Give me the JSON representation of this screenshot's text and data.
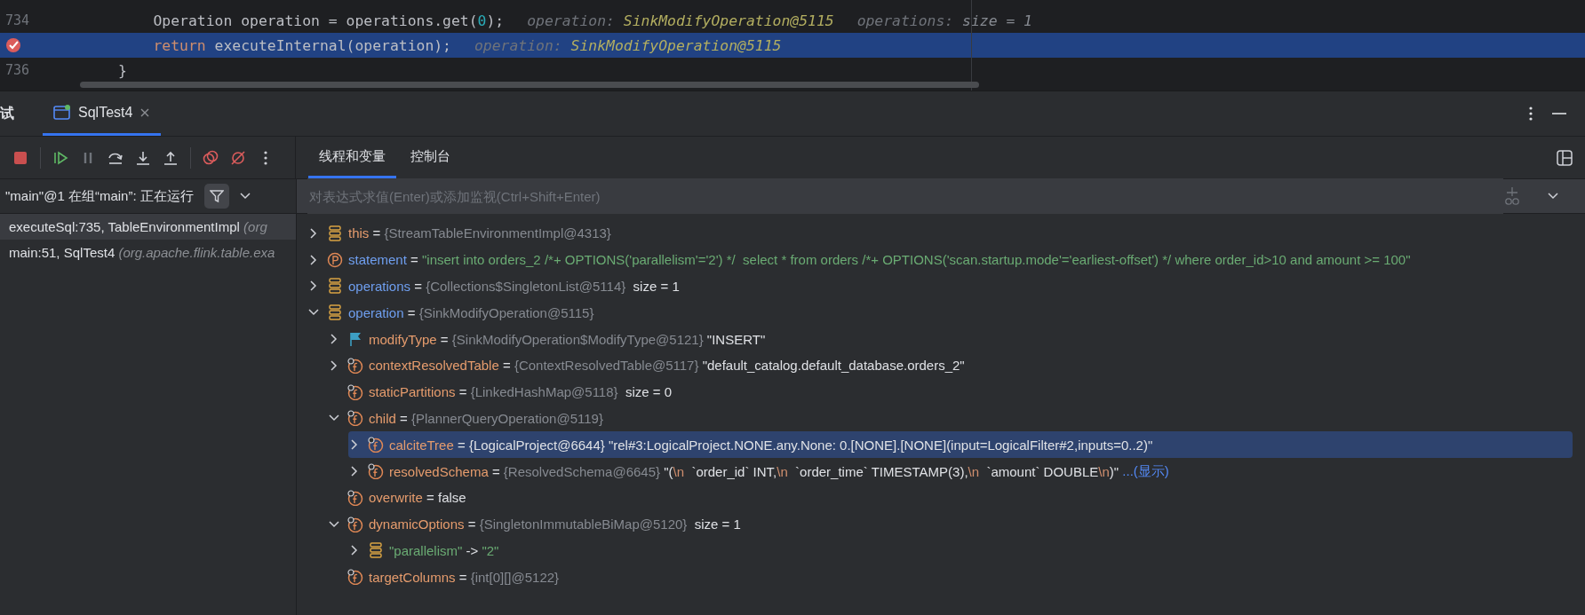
{
  "editor": {
    "lines": [
      {
        "number": "734",
        "selected": false,
        "breakpoint": false,
        "code": [
          {
            "kind": "code",
            "text": "    Operation operation = operations.get("
          },
          {
            "kind": "number",
            "text": "0"
          },
          {
            "kind": "code",
            "text": ");"
          }
        ],
        "hints": [
          {
            "label": "operation:",
            "value": "SinkModifyOperation@5115",
            "kind": "object"
          },
          {
            "label": "operations:",
            "value": "size = 1",
            "kind": "plain"
          }
        ]
      },
      {
        "selected": true,
        "breakpoint": true,
        "code": [
          {
            "kind": "keyword",
            "text": "    return"
          },
          {
            "kind": "code",
            "text": " executeInternal(operation);"
          }
        ],
        "hints": [
          {
            "label": "operation:",
            "value": "SinkModifyOperation@5115",
            "kind": "object"
          }
        ]
      },
      {
        "number": "736",
        "selected": false,
        "breakpoint": false,
        "code": [
          {
            "kind": "code",
            "text": "}"
          }
        ]
      }
    ]
  },
  "tool_window": {
    "title": "试",
    "tabs": [
      {
        "label": "SqlTest4",
        "selected": true
      }
    ]
  },
  "panel_tabs": [
    {
      "label": "线程和变量",
      "selected": true
    },
    {
      "label": "控制台",
      "selected": false
    }
  ],
  "thread": {
    "label": "\"main\"@1 在组“main”: 正在运行"
  },
  "frames": [
    {
      "method": "executeSql:735, TableEnvironmentImpl",
      "location": "(org",
      "selected": true
    },
    {
      "method": "main:51, SqlTest4",
      "location": "(org.apache.flink.table.exa",
      "selected": false
    }
  ],
  "evaluate": {
    "placeholder": "对表达式求值(Enter)或添加监视(Ctrl+Shift+Enter)"
  },
  "variables": [
    {
      "kind": "this",
      "name": "this",
      "expanded": false,
      "selected": false,
      "value": [
        {
          "kind": "op",
          "text": " = "
        },
        {
          "kind": "type",
          "text": "{StreamTableEnvironmentImpl@4313}"
        }
      ]
    },
    {
      "kind": "param",
      "name": "statement",
      "expanded": false,
      "selected": false,
      "value": [
        {
          "kind": "op",
          "text": " = "
        },
        {
          "kind": "str",
          "text": "\"insert into orders_2 /*+ OPTIONS('parallelism'='2') */  select * from orders /*+ OPTIONS('scan.startup.mode'='earliest-offset') */ where order_id>10 and amount >= 100\""
        }
      ]
    },
    {
      "kind": "local",
      "name": "operations",
      "expanded": false,
      "selected": false,
      "value": [
        {
          "kind": "op",
          "text": " = "
        },
        {
          "kind": "type",
          "text": "{Collections$SingletonList@5114}"
        },
        {
          "kind": "plain",
          "text": "  size = 1"
        }
      ]
    },
    {
      "kind": "local",
      "name": "operation",
      "expanded": true,
      "selected": false,
      "value": [
        {
          "kind": "op",
          "text": " = "
        },
        {
          "kind": "type",
          "text": "{SinkModifyOperation@5115}"
        }
      ],
      "children": [
        {
          "kind": "enum",
          "name": "modifyType",
          "expanded": false,
          "selected": false,
          "value": [
            {
              "kind": "op",
              "text": " = "
            },
            {
              "kind": "type",
              "text": "{SinkModifyOperation$ModifyType@5121}"
            },
            {
              "kind": "plain",
              "text": " \"INSERT\""
            }
          ]
        },
        {
          "kind": "field",
          "name": "contextResolvedTable",
          "expanded": false,
          "selected": false,
          "value": [
            {
              "kind": "op",
              "text": " = "
            },
            {
              "kind": "type",
              "text": "{ContextResolvedTable@5117}"
            },
            {
              "kind": "plain",
              "text": " \"default_catalog.default_database.orders_2\""
            }
          ]
        },
        {
          "kind": "field",
          "name": "staticPartitions",
          "selected": false,
          "value": [
            {
              "kind": "op",
              "text": " = "
            },
            {
              "kind": "type",
              "text": "{LinkedHashMap@5118}"
            },
            {
              "kind": "plain",
              "text": "  size = 0"
            }
          ]
        },
        {
          "kind": "field",
          "name": "child",
          "expanded": true,
          "selected": false,
          "value": [
            {
              "kind": "op",
              "text": " = "
            },
            {
              "kind": "type",
              "text": "{PlannerQueryOperation@5119}"
            }
          ],
          "children": [
            {
              "kind": "field",
              "name": "calciteTree",
              "expanded": false,
              "selected": true,
              "value": [
                {
                  "kind": "op",
                  "text": " = "
                },
                {
                  "kind": "type",
                  "text": "{LogicalProject@6644}"
                },
                {
                  "kind": "plain",
                  "text": " \"rel#3:LogicalProject.NONE.any.None: 0.[NONE].[NONE](input=LogicalFilter#2,inputs=0..2)\""
                }
              ]
            },
            {
              "kind": "field",
              "name": "resolvedSchema",
              "expanded": false,
              "selected": false,
              "value": [
                {
                  "kind": "op",
                  "text": " = "
                },
                {
                  "kind": "type",
                  "text": "{ResolvedSchema@6645}"
                },
                {
                  "kind": "plain",
                  "text": " \"("
                },
                {
                  "kind": "esc",
                  "text": "\\n"
                },
                {
                  "kind": "plain",
                  "text": "  `order_id` INT,"
                },
                {
                  "kind": "esc",
                  "text": "\\n"
                },
                {
                  "kind": "plain",
                  "text": "  `order_time` TIMESTAMP(3),"
                },
                {
                  "kind": "esc",
                  "text": "\\n"
                },
                {
                  "kind": "plain",
                  "text": "  `amount` DOUBLE"
                },
                {
                  "kind": "esc",
                  "text": "\\n"
                },
                {
                  "kind": "plain",
                  "text": ")\" "
                },
                {
                  "kind": "link",
                  "text": "...(显示)"
                }
              ]
            }
          ]
        },
        {
          "kind": "field",
          "name": "overwrite",
          "selected": false,
          "value": [
            {
              "kind": "op",
              "text": " = "
            },
            {
              "kind": "plain",
              "text": "false"
            }
          ]
        },
        {
          "kind": "field",
          "name": "dynamicOptions",
          "expanded": true,
          "selected": false,
          "value": [
            {
              "kind": "op",
              "text": " = "
            },
            {
              "kind": "type",
              "text": "{SingletonImmutableBiMap@5120}"
            },
            {
              "kind": "plain",
              "text": "  size = 1"
            }
          ],
          "children": [
            {
              "kind": "entry",
              "expanded": false,
              "selected": false,
              "value": [
                {
                  "kind": "str",
                  "text": "\"parallelism\""
                },
                {
                  "kind": "op",
                  "text": " -> "
                },
                {
                  "kind": "str",
                  "text": "\"2\""
                }
              ]
            }
          ]
        },
        {
          "kind": "field",
          "name": "targetColumns",
          "selected": false,
          "value": [
            {
              "kind": "op",
              "text": " = "
            },
            {
              "kind": "type",
              "text": "{int[0][]@5122}"
            }
          ]
        }
      ]
    }
  ]
}
